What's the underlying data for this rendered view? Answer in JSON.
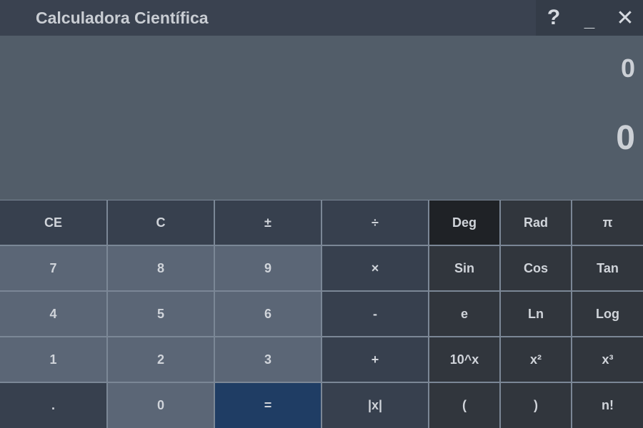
{
  "window": {
    "title": "Calculadora Científica",
    "help_label": "?",
    "minimize_label": "_",
    "close_label": "✕"
  },
  "display": {
    "expression": "0",
    "result": "0"
  },
  "keys": {
    "ce": "CE",
    "c": "C",
    "plus_minus": "±",
    "divide": "÷",
    "deg": "Deg",
    "rad": "Rad",
    "pi": "π",
    "seven": "7",
    "eight": "8",
    "nine": "9",
    "multiply": "×",
    "sin": "Sin",
    "cos": "Cos",
    "tan": "Tan",
    "four": "4",
    "five": "5",
    "six": "6",
    "minus": "-",
    "e": "e",
    "ln": "Ln",
    "log": "Log",
    "one": "1",
    "two": "2",
    "three": "3",
    "plus": "+",
    "ten_pow": "10^x",
    "square": "x²",
    "cube": "x³",
    "dot": ".",
    "zero": "0",
    "equals": "=",
    "abs": "|x|",
    "lparen": "(",
    "rparen": ")",
    "factorial": "n!"
  },
  "colors": {
    "equals_accent": "#1f3d64",
    "deg_active": "#1f2226"
  }
}
